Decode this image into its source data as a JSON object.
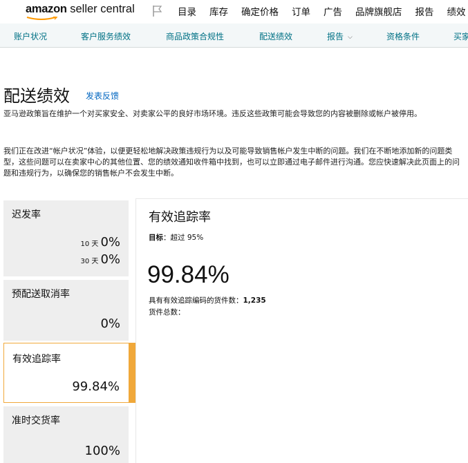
{
  "header": {
    "logo_bold": "amazon",
    "logo_rest": " seller central",
    "nav": [
      "目录",
      "库存",
      "确定价格",
      "订单",
      "广告",
      "品牌旗舰店",
      "报告",
      "绩效"
    ]
  },
  "subnav": {
    "items": [
      "账户状况",
      "客户服务绩效",
      "商品政策合规性",
      "配送绩效",
      "报告",
      "资格条件",
      "买家"
    ]
  },
  "page": {
    "title": "配送绩效",
    "feedback": "发表反馈",
    "desc1": "亚马逊政策旨在维护一个对买家安全、对卖家公平的良好市场环境。违反这些政策可能会导致您的内容被删除或帐户被停用。",
    "desc2": "我们正在改进“帐户状况”体验，以便更轻松地解决政策违规行为以及可能导致销售帐户发生中断的问题。我们在不断地添加新的问题类型，这些问题可以在卖家中心的其他位置、您的绩效通知收件箱中找到，也可以立即通过电子邮件进行沟通。您应快速解决此页面上的问题和违规行为，以确保您的销售帐户不会发生中断。"
  },
  "metrics": {
    "late": {
      "title": "迟发率",
      "label10": "10 天",
      "value10": "0%",
      "label30": "30 天",
      "value30": "0%"
    },
    "cancel": {
      "title": "预配送取消率",
      "value": "0%"
    },
    "tracking": {
      "title": "有效追踪率",
      "value": "99.84%"
    },
    "ontime": {
      "title": "准时交货率",
      "value": "100%"
    }
  },
  "panel": {
    "title": "有效追踪率",
    "target_label": "目标",
    "target_value": "：超过 95%",
    "big_value": "99.84%",
    "tracked_label": "具有有效追踪编码的货件数：",
    "tracked_value": "1,235",
    "total_label": "货件总数：",
    "total_value": ""
  },
  "colors": {
    "accent": "#f0a83a",
    "link": "#007185",
    "card_bg": "#eeeeee"
  },
  "icons": {
    "flag": "flag-icon",
    "chevron": "chevron-down-icon"
  }
}
